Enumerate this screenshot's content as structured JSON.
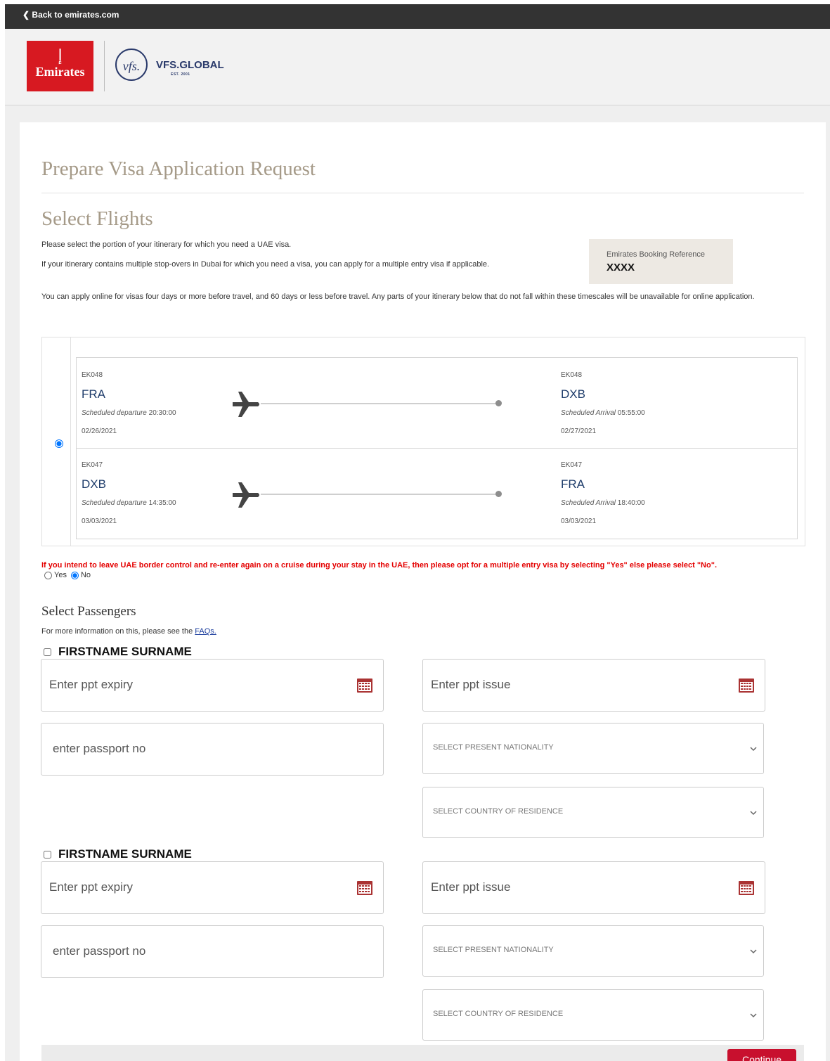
{
  "topbar": {
    "back_label": "Back to emirates.com"
  },
  "logos": {
    "emirates_text": "Emirates",
    "vfs_mark": "vfs.",
    "vfs_text": "VFS.GLOBAL",
    "vfs_est": "EST. 2001"
  },
  "page": {
    "title": "Prepare Visa Application Request",
    "section_title": "Select Flights",
    "intro_1": "Please select the portion of your itinerary for which you need a UAE visa.",
    "intro_2": "If your itinerary contains multiple stop-overs in Dubai for which you need a visa, you can apply for a multiple entry visa if applicable.",
    "intro_3": "You can apply online for visas four days or more before travel, and 60 days or less before travel. Any parts of your itinerary below that do not fall within these timescales will be unavailable for online application."
  },
  "booking": {
    "label": "Emirates Booking Reference",
    "value": "XXXX"
  },
  "legs": [
    {
      "dep_flight": "EK048",
      "dep_airport": "FRA",
      "dep_sched_label": "Scheduled departure",
      "dep_time": "20:30:00",
      "dep_date": "02/26/2021",
      "arr_flight": "EK048",
      "arr_airport": "DXB",
      "arr_sched_label": "Scheduled Arrival",
      "arr_time": "05:55:00",
      "arr_date": "02/27/2021"
    },
    {
      "dep_flight": "EK047",
      "dep_airport": "DXB",
      "dep_sched_label": "Scheduled departure",
      "dep_time": "14:35:00",
      "dep_date": "03/03/2021",
      "arr_flight": "EK047",
      "arr_airport": "FRA",
      "arr_sched_label": "Scheduled Arrival",
      "arr_time": "18:40:00",
      "arr_date": "03/03/2021"
    }
  ],
  "multi_entry": {
    "warning": "If you intend to leave UAE border control and re-enter again on a cruise during your stay in the UAE, then please opt for a multiple entry visa by selecting \"Yes\" else please select \"No\".",
    "yes_label": "Yes",
    "no_label": "No",
    "selected": "No"
  },
  "passengers_section": {
    "title": "Select Passengers",
    "faq_text": "For more information on this, please see the",
    "faq_link": "FAQs."
  },
  "passengers": [
    {
      "name": "FIRSTNAME SURNAME",
      "ppt_expiry_placeholder": "Enter ppt expiry",
      "ppt_issue_placeholder": "Enter ppt issue",
      "passport_placeholder": "enter passport no",
      "nationality_placeholder": "SELECT PRESENT NATIONALITY",
      "residence_placeholder": "SELECT COUNTRY OF RESIDENCE"
    },
    {
      "name": "FIRSTNAME SURNAME",
      "ppt_expiry_placeholder": "Enter ppt expiry",
      "ppt_issue_placeholder": "Enter ppt issue",
      "passport_placeholder": "enter passport no",
      "nationality_placeholder": "SELECT PRESENT NATIONALITY",
      "residence_placeholder": "SELECT COUNTRY OF RESIDENCE"
    }
  ],
  "actions": {
    "continue_label": "Continue"
  },
  "colors": {
    "brand_red": "#d71921",
    "title_tan": "#a59a88",
    "airport_blue": "#1f3d6b",
    "warning_red": "#e40000",
    "continue_red": "#c8102e"
  },
  "icons": {
    "back": "chevron-left-icon",
    "plane": "plane-icon",
    "calendar": "calendar-icon",
    "dropdown": "chevron-down-icon"
  }
}
